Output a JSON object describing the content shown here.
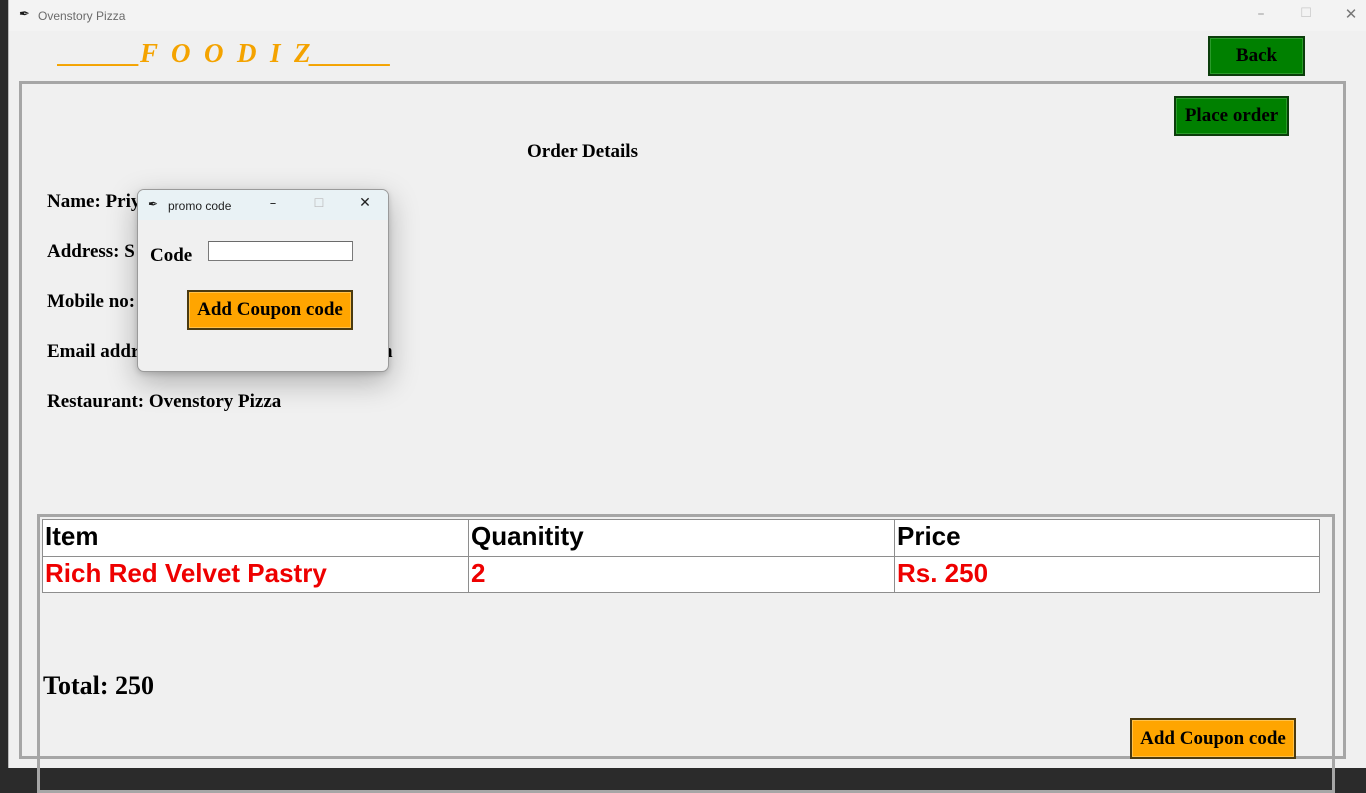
{
  "window": {
    "title": "Ovenstory Pizza",
    "app_icon": "feather-icon",
    "controls": {
      "minimize": "–",
      "maximize": "☐",
      "close": "✕"
    }
  },
  "header": {
    "brand": "______F  O  O  D  I  Z______",
    "back_label": "Back"
  },
  "actions": {
    "place_order_label": "Place order",
    "add_coupon_label": "Add Coupon code"
  },
  "order": {
    "section_title": "Order Details",
    "name_label": "Name: Priy",
    "address_label": "Address: S",
    "mobile_label": "Mobile no:",
    "email_label": "Email addr",
    "email_tail": "n",
    "restaurant_label": "Restaurant: Ovenstory Pizza"
  },
  "table": {
    "columns": [
      "Item",
      "Quanitity",
      "Price"
    ],
    "rows": [
      [
        "Rich Red Velvet Pastry",
        "2",
        "Rs. 250"
      ]
    ]
  },
  "total_label": "Total: 250",
  "popup": {
    "title": "promo code",
    "code_label": "Code",
    "code_value": "",
    "add_button_label": "Add Coupon code"
  },
  "colors": {
    "brand": "#f4a300",
    "green_button": "#008000",
    "orange_button": "#ffa500",
    "row_text": "#ee0000"
  }
}
